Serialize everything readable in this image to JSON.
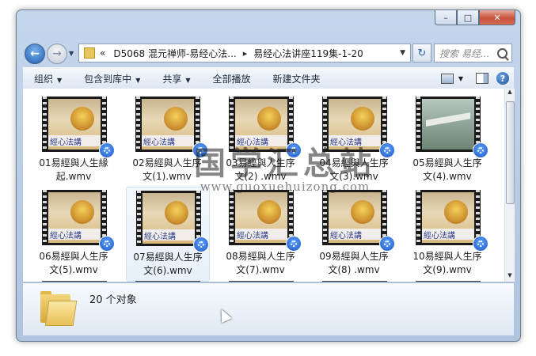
{
  "window": {
    "caption": {
      "minimize": "–",
      "maximize": "□",
      "close": "✕"
    }
  },
  "nav": {
    "back_glyph": "←",
    "forward_glyph": "→",
    "address": {
      "overflow": "«",
      "segments": [
        "D5068 混元禅师-易经心法...",
        "易经心法讲座119集-1-20"
      ],
      "separator": "▸"
    },
    "refresh_glyph": "↻",
    "search_placeholder": "搜索 易经..."
  },
  "toolbar": {
    "organize": "组织",
    "include_in_library": "包含到库中",
    "share": "共享",
    "play_all": "全部播放",
    "new_folder": "新建文件夹"
  },
  "thumb_band_text": "經心法講",
  "files": [
    {
      "name_line1": "01易經與人生緣",
      "name_line2": "起.wmv"
    },
    {
      "name_line1": "02易經與人生序",
      "name_line2": "文(1).wmv"
    },
    {
      "name_line1": "03易經與人生序",
      "name_line2": "文(2) .wmv"
    },
    {
      "name_line1": "04易經與人生序",
      "name_line2": "文(3).wmv"
    },
    {
      "name_line1": "05易經與人生序",
      "name_line2": "文(4).wmv"
    },
    {
      "name_line1": "06易經與人生序",
      "name_line2": "文(5).wmv"
    },
    {
      "name_line1": "07易經與人生序",
      "name_line2": "文(6).wmv"
    },
    {
      "name_line1": "08易經與人生序",
      "name_line2": "文(7).wmv"
    },
    {
      "name_line1": "09易經與人生序",
      "name_line2": "文(8) .wmv"
    },
    {
      "name_line1": "10易經與人生序",
      "name_line2": "文(9).wmv"
    }
  ],
  "details": {
    "count": "20 个对象"
  },
  "watermark": {
    "text": "国学汇总站",
    "url": "www.guoxuehuizong.com"
  },
  "colors": {
    "accent": "#1e5fb3",
    "selection": "#e7f0fa"
  }
}
